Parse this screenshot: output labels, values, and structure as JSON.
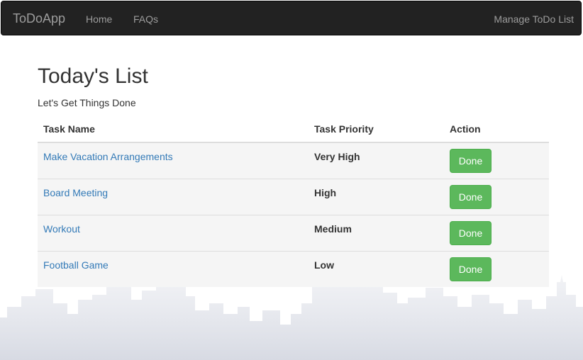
{
  "navbar": {
    "brand": "ToDoApp",
    "links": [
      "Home",
      "FAQs"
    ],
    "right_link": "Manage ToDo List"
  },
  "page": {
    "title": "Today's List",
    "subtitle": "Let's Get Things Done"
  },
  "table": {
    "headers": [
      "Task Name",
      "Task Priority",
      "Action"
    ],
    "rows": [
      {
        "name": "Make Vacation Arrangements",
        "priority": "Very High",
        "action": "Done"
      },
      {
        "name": "Board Meeting",
        "priority": "High",
        "action": "Done"
      },
      {
        "name": "Workout",
        "priority": "Medium",
        "action": "Done"
      },
      {
        "name": "Football Game",
        "priority": "Low",
        "action": "Done"
      }
    ]
  },
  "colors": {
    "navbar_bg": "#222222",
    "link": "#337ab7",
    "done_button": "#5cb85c",
    "skyline": "#dde0e8"
  }
}
